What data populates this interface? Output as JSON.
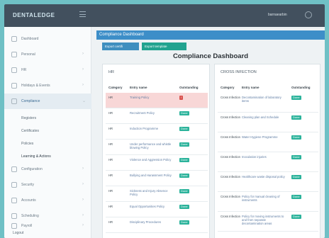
{
  "topbar": {
    "brand": "DENTALEDGE",
    "user": "barnaearbin"
  },
  "sidebar": {
    "items": [
      {
        "label": "Dashboard",
        "icon": "home-icon"
      },
      {
        "label": "Personal",
        "icon": "user-icon"
      },
      {
        "label": "HR",
        "icon": "users-icon"
      },
      {
        "label": "Holidays & Events",
        "icon": "calendar-icon"
      },
      {
        "label": "Compliance",
        "icon": "clipboard-icon"
      }
    ],
    "subitems": [
      "Registers",
      "Certificates",
      "Policies",
      "Learning & Actions"
    ],
    "lower_items": [
      {
        "label": "Configuration",
        "icon": "gear-icon"
      },
      {
        "label": "Security",
        "icon": "key-icon"
      },
      {
        "label": "Accounts",
        "icon": "document-icon"
      },
      {
        "label": "Scheduling",
        "icon": "calendar-icon"
      },
      {
        "label": "Payroll",
        "icon": "money-icon"
      }
    ],
    "logout": "Logout"
  },
  "panel": {
    "title": "Compliance Dashboard"
  },
  "buttons": {
    "export_cert": "Export certifi",
    "export_template": "Export template"
  },
  "page_title": "Compliance Dashboard",
  "cards": {
    "hr": {
      "title": "HR",
      "headers": [
        "Category",
        "Entry name",
        "Outstanding"
      ],
      "rows": [
        {
          "cat": "HR",
          "name": "Training Policy",
          "status": "!",
          "bad": true
        },
        {
          "cat": "HR",
          "name": "Recruitment Policy",
          "status": "Done"
        },
        {
          "cat": "HR",
          "name": "Induction Programme",
          "status": "Done"
        },
        {
          "cat": "HR",
          "name": "Under performance and whistle blowing Policy",
          "status": "Done"
        },
        {
          "cat": "HR",
          "name": "Violence and Aggression Policy",
          "status": "Done"
        },
        {
          "cat": "HR",
          "name": "Bullying and Harassment Policy",
          "status": "Done"
        },
        {
          "cat": "HR",
          "name": "Sickness and Injury Absence Policy",
          "status": "Done"
        },
        {
          "cat": "HR",
          "name": "Equal Opportunities Policy",
          "status": "Done"
        },
        {
          "cat": "HR",
          "name": "Disciplinary Procedures",
          "status": "Done"
        }
      ]
    },
    "cross": {
      "title": "CROSS INFECTION",
      "headers": [
        "Category",
        "Entry name",
        "Outstanding"
      ],
      "rows": [
        {
          "cat": "Cross Infection",
          "name": "Decontamination of laboratory items",
          "status": "Done"
        },
        {
          "cat": "Cross Infection",
          "name": "Cleaning plan and Schedule",
          "status": "Done"
        },
        {
          "cat": "Cross Infection",
          "name": "Water Hygiene Programme",
          "status": "Done"
        },
        {
          "cat": "Cross Infection",
          "name": "Inoculation injuries",
          "status": "Done"
        },
        {
          "cat": "Cross Infection",
          "name": "Healthcare waste disposal policy",
          "status": "Done"
        },
        {
          "cat": "Cross Infection",
          "name": "Policy for manual cleaning of instruments",
          "status": "Done"
        },
        {
          "cat": "Cross Infection",
          "name": "Policy for moving instruments to and from separate decontamination areas",
          "status": "Done"
        }
      ]
    }
  }
}
